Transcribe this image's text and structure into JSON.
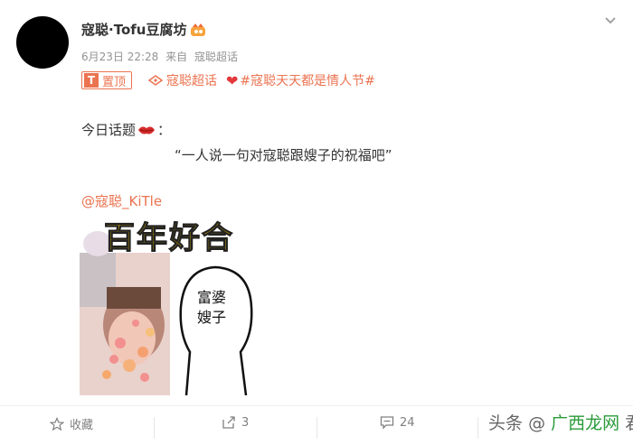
{
  "header": {
    "username": "寇聪·Tofu豆腐坊",
    "date": "6月23日 22:28",
    "source_prefix": "来自",
    "source": "寇聪超话"
  },
  "tags": {
    "pinned_label": "置顶",
    "super_topic": "寇聪超话",
    "hashtag": "#寇聪天天都是情人节#"
  },
  "post": {
    "line1_prefix": "今日话题",
    "line1_suffix": "：",
    "line2": "“一人说一句对寇聪跟嫂子的祝福吧”",
    "mention": "@寇聪_KiTle"
  },
  "image": {
    "title": "百年好合",
    "bubble_line1": "富婆",
    "bubble_line2": "嫂子"
  },
  "actions": {
    "favorite": "收藏",
    "repost_count": "3",
    "comment_count": "24"
  },
  "watermark": {
    "prefix": "头条",
    "sep": "@",
    "accent": "广西龙网",
    "suffix": "君"
  },
  "colors": {
    "accent": "#eb7350",
    "heart": "#e4393c",
    "muted": "#939393"
  }
}
